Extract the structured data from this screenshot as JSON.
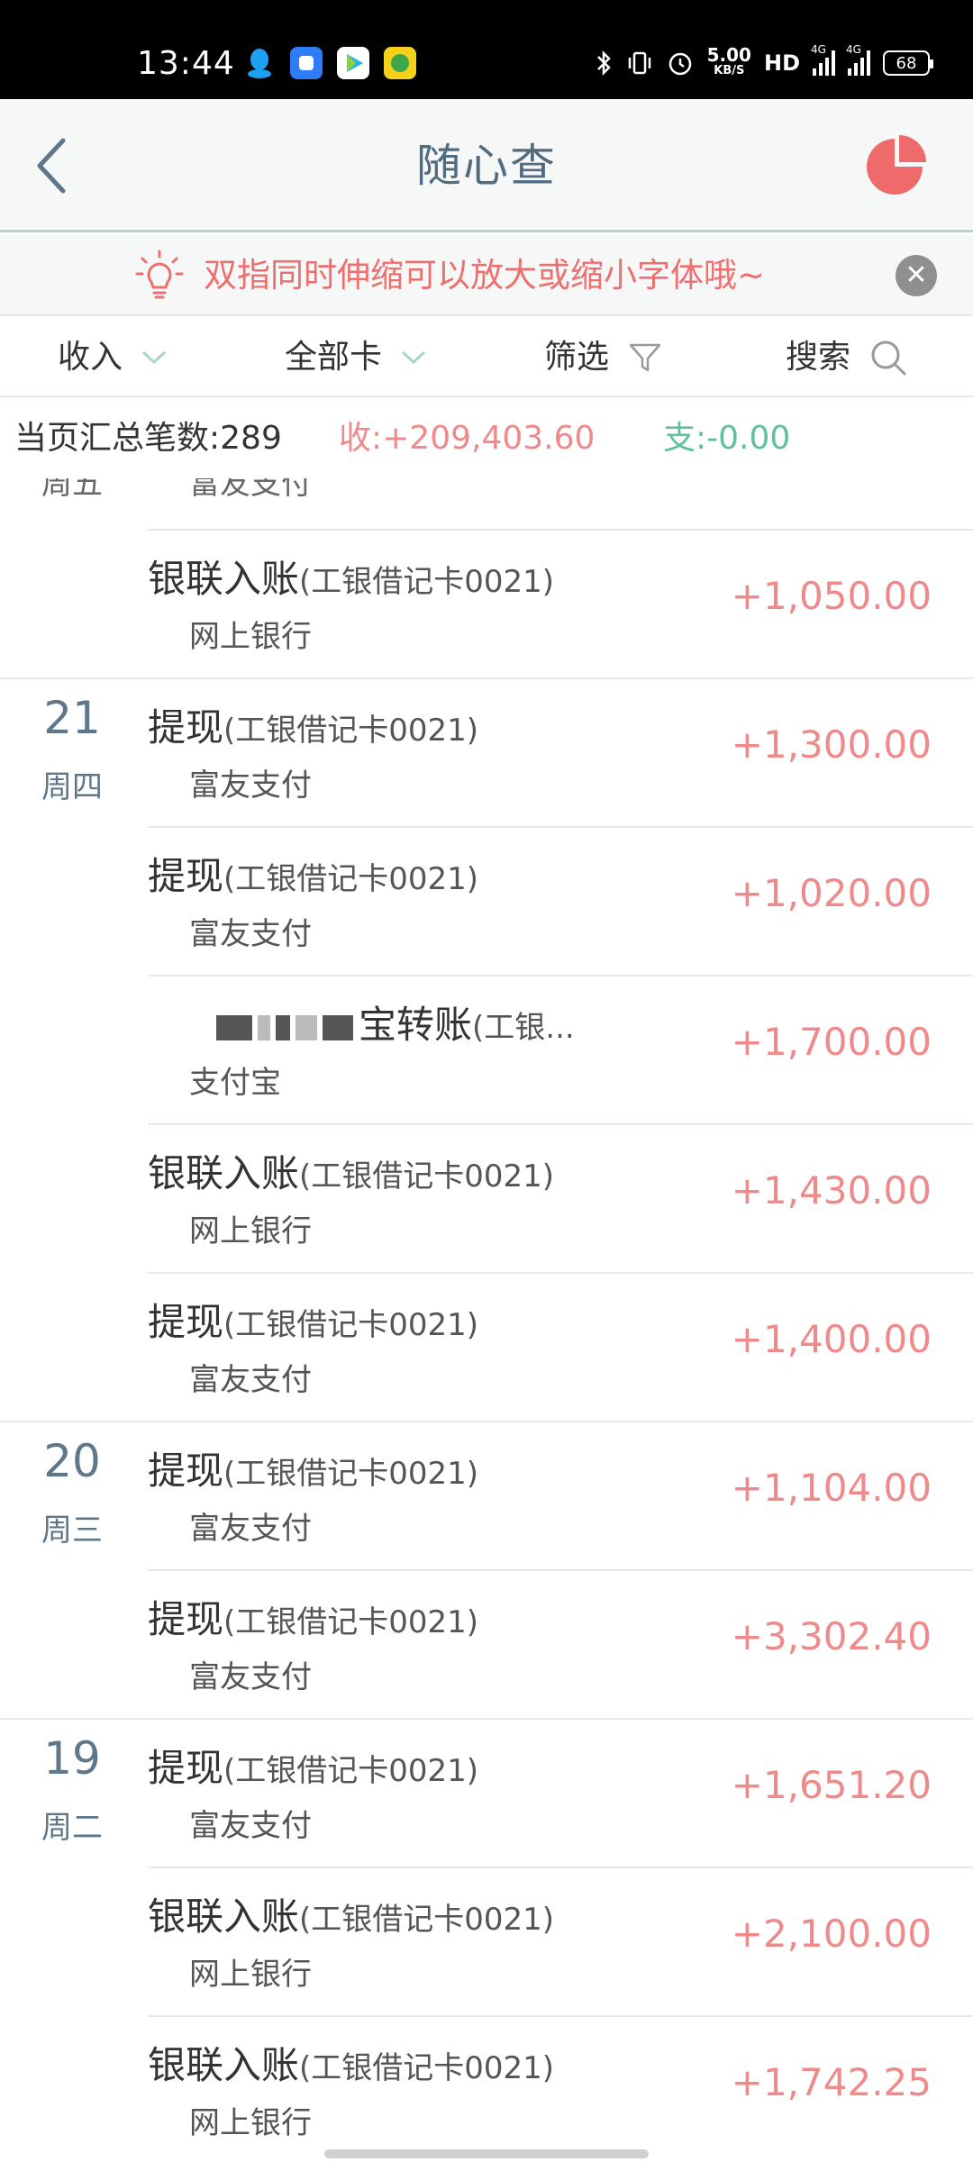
{
  "status": {
    "time": "13:44",
    "speed_top": "5.00",
    "speed_unit": "KB/S",
    "hd": "HD",
    "net1": "4G",
    "net2": "4G",
    "battery": "68"
  },
  "title": {
    "text": "随心查"
  },
  "tip": {
    "text": "双指同时伸缩可以放大或缩小字体哦~"
  },
  "filters": {
    "income": "收入",
    "cards": "全部卡",
    "filter": "筛选",
    "search": "搜索"
  },
  "summary": {
    "count": "当页汇总笔数:289",
    "income": "收:+209,403.60",
    "expense": "支:-0.00"
  },
  "partial_top": {
    "week": "周五",
    "sub": "富友支付"
  },
  "transactions": [
    {
      "day": "",
      "week": "",
      "title": "银联入账",
      "card": "(工银借记卡0021)",
      "sub": "网上银行",
      "amount": "+1,050.00"
    },
    {
      "day": "21",
      "week": "周四",
      "title": "提现",
      "card": "(工银借记卡0021)",
      "sub": "富友支付",
      "amount": "+1,300.00"
    },
    {
      "day": "",
      "week": "",
      "title": "提现",
      "card": "(工银借记卡0021)",
      "sub": "富友支付",
      "amount": "+1,020.00"
    },
    {
      "day": "",
      "week": "",
      "title": "宝转账",
      "card": "(工银...",
      "sub": "支付宝",
      "amount": "+1,700.00"
    },
    {
      "day": "",
      "week": "",
      "title": "银联入账",
      "card": "(工银借记卡0021)",
      "sub": "网上银行",
      "amount": "+1,430.00"
    },
    {
      "day": "",
      "week": "",
      "title": "提现",
      "card": "(工银借记卡0021)",
      "sub": "富友支付",
      "amount": "+1,400.00"
    },
    {
      "day": "20",
      "week": "周三",
      "title": "提现",
      "card": "(工银借记卡0021)",
      "sub": "富友支付",
      "amount": "+1,104.00"
    },
    {
      "day": "",
      "week": "",
      "title": "提现",
      "card": "(工银借记卡0021)",
      "sub": "富友支付",
      "amount": "+3,302.40"
    },
    {
      "day": "19",
      "week": "周二",
      "title": "提现",
      "card": "(工银借记卡0021)",
      "sub": "富友支付",
      "amount": "+1,651.20"
    },
    {
      "day": "",
      "week": "",
      "title": "银联入账",
      "card": "(工银借记卡0021)",
      "sub": "网上银行",
      "amount": "+2,100.00"
    },
    {
      "day": "",
      "week": "",
      "title": "银联入账",
      "card": "(工银借记卡0021)",
      "sub": "网上银行",
      "amount": "+1,742.25"
    }
  ]
}
